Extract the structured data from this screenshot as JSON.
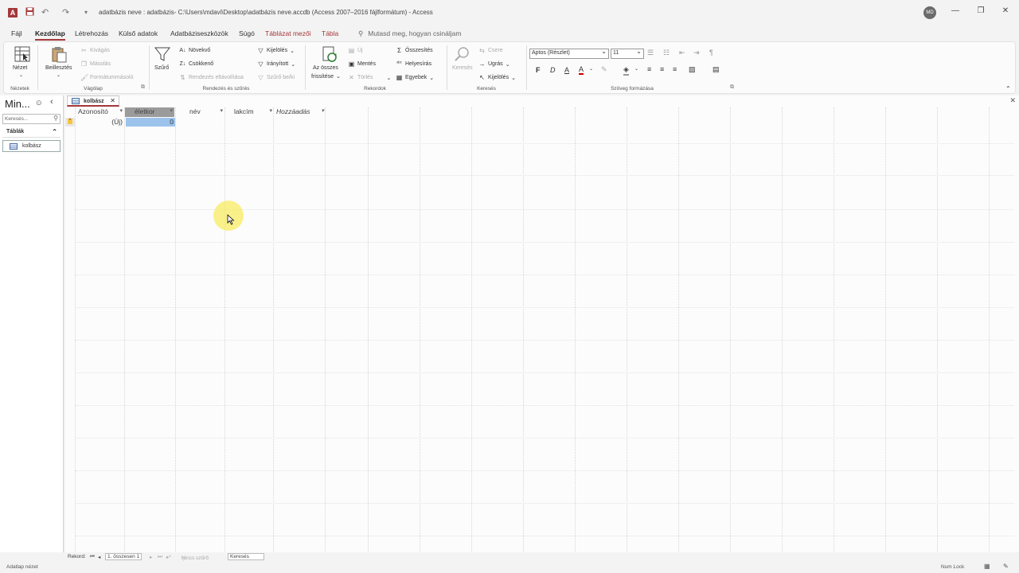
{
  "app": {
    "title": "adatbázis neve : adatbázis- C:\\Users\\mdavi\\Desktop\\adatbázis neve.accdb (Access 2007–2016 fájlformátum) - Access",
    "user_initials": "MD"
  },
  "menu": {
    "items": [
      "Fájl",
      "Kezdőlap",
      "Létrehozás",
      "Külső adatok",
      "Adatbáziseszközök",
      "Súgó",
      "Táblázat mezői",
      "Tábla"
    ],
    "active": "Kezdőlap",
    "search_placeholder": "Mutasd meg, hogyan csináljam"
  },
  "ribbon": {
    "views": {
      "view_label": "Nézet",
      "group": "Nézetek"
    },
    "clipboard": {
      "paste": "Beillesztés",
      "cut": "Kivágás",
      "copy": "Másolás",
      "format_painter": "Formátummásoló",
      "group": "Vágólap"
    },
    "sort_filter": {
      "filter": "Szűrő",
      "ascending": "Növekvő",
      "descending": "Csökkenő",
      "remove_sort": "Rendezés eltávolítása",
      "selection": "Kijelölés",
      "advanced": "Irányított",
      "toggle_filter": "Szűrő be/ki",
      "group": "Rendezés és szűrés"
    },
    "records": {
      "refresh_line1": "Az összes",
      "refresh_line2": "frissítése",
      "new": "Új",
      "save": "Mentés",
      "delete": "Törlés",
      "totals": "Összesítés",
      "spelling": "Helyesírás",
      "more": "Egyebek",
      "group": "Rekordok"
    },
    "find": {
      "find": "Keresés",
      "replace": "Csere",
      "goto": "Ugrás",
      "select": "Kijelölés",
      "group": "Keresés"
    },
    "text_format": {
      "font": "Aptos (Részlet)",
      "size": "11",
      "bold": "F",
      "italic": "D",
      "underline": "A",
      "group": "Szöveg formázása"
    }
  },
  "nav_pane": {
    "title": "Min...",
    "search_placeholder": "Keresés...",
    "section": "Táblák",
    "items": [
      "kolbász"
    ]
  },
  "document": {
    "tab_label": "kolbász",
    "columns": [
      "Azonosító",
      "életkor",
      "név",
      "lakcím",
      "Hozzáadás"
    ],
    "new_row": {
      "id": "(Új)",
      "age": "0"
    }
  },
  "record_nav": {
    "label": "Rekord:",
    "position": "1. összesen 1",
    "filter_state": "Nincs szűrő",
    "search": "Keresés"
  },
  "status": {
    "view": "Adatlap nézet",
    "num_lock": "Num Lock"
  }
}
